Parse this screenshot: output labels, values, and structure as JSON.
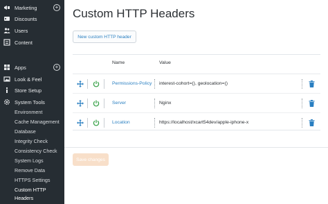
{
  "sidebar": {
    "items": [
      {
        "label": "Marketing",
        "icon": "megaphone-icon",
        "has_plus": true
      },
      {
        "label": "Discounts",
        "icon": "discount-icon"
      },
      {
        "label": "Users",
        "icon": "users-icon"
      },
      {
        "label": "Content",
        "icon": "content-icon"
      },
      {
        "label": "Apps",
        "icon": "apps-icon",
        "has_plus": true
      },
      {
        "label": "Look & Feel",
        "icon": "image-icon"
      },
      {
        "label": "Store Setup",
        "icon": "info-icon"
      },
      {
        "label": "System Tools",
        "icon": "gear-icon"
      }
    ],
    "subitems": [
      "Environment",
      "Cache Management",
      "Database",
      "Integrity Check",
      "Consistency Check",
      "System Logs",
      "Remove Data",
      "HTTPS Settings"
    ],
    "active_subitem": {
      "line1": "Custom HTTP",
      "line2": "Headers"
    },
    "plus_symbol": "+"
  },
  "main": {
    "title": "Custom HTTP Headers",
    "new_button": "New custom HTTP header",
    "columns": {
      "name": "Name",
      "value": "Value"
    },
    "rows": [
      {
        "name": "Permissions-Policy",
        "value": "interest-cohort=(), geolocation=()"
      },
      {
        "name": "Server",
        "value": "Nginx"
      },
      {
        "name": "Location",
        "value": "https://localhost/xcart54dev/apple-iphone-x"
      }
    ],
    "save_button": "Save changes"
  },
  "colors": {
    "sidebar_bg": "#262d33",
    "link": "#2a7fc1",
    "power_on": "#3aa34a",
    "save_disabled": "#f8dfc9"
  }
}
